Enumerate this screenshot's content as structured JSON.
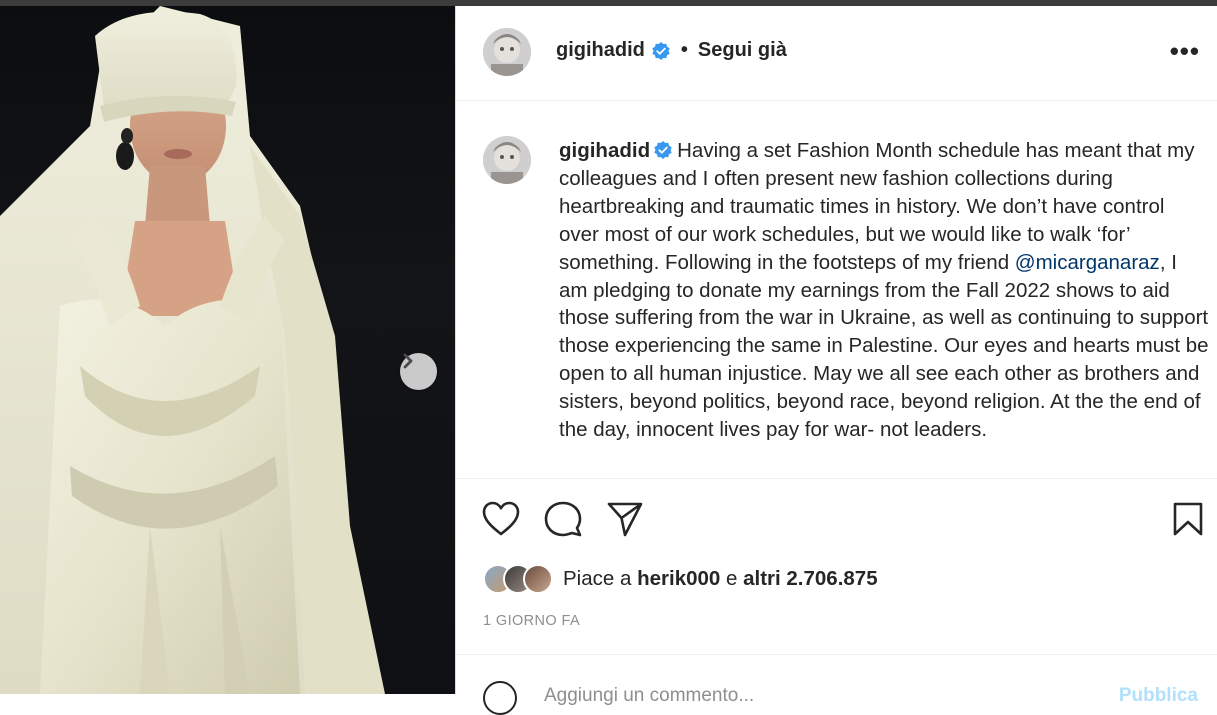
{
  "post": {
    "username": "gigihadid",
    "follow_separator": "•",
    "follow_status": "Segui già",
    "more_label": "•••",
    "caption_before_mention": "Having a set Fashion Month schedule has meant that my colleagues and I often present new fashion collections during heartbreaking and traumatic times in history. We don’t have control over most of our work schedules, but we would like to walk ‘for’ something. Following in the footsteps of my friend ",
    "mention": "@micarganaraz",
    "caption_after_mention": ", I am pledging to donate my earnings from the Fall 2022 shows to aid those suffering from the war in Ukraine, as well as continuing to support those experiencing the same in Palestine. Our eyes and hearts must be open to all human injustice. May we all see each other as brothers and sisters, beyond politics, beyond race, beyond religion. At the the end of the day, innocent lives pay for war- not leaders.",
    "likes_prefix": "Piace a",
    "likes_user": "herik000",
    "likes_conj": "e",
    "likes_others": "altri 2.706.875",
    "timestamp": "1 GIORNO FA",
    "comment_placeholder": "Aggiungi un commento...",
    "publish_label": "Pubblica"
  },
  "icons": {
    "verified": "verified-badge-icon",
    "next": "chevron-right-icon",
    "like": "heart-icon",
    "comment": "comment-bubble-icon",
    "share": "paper-plane-icon",
    "save": "bookmark-icon",
    "emoji": "emoji-icon"
  },
  "colors": {
    "verified_blue": "#3897f0",
    "mention": "#00376b",
    "muted": "#8e8e8e"
  }
}
